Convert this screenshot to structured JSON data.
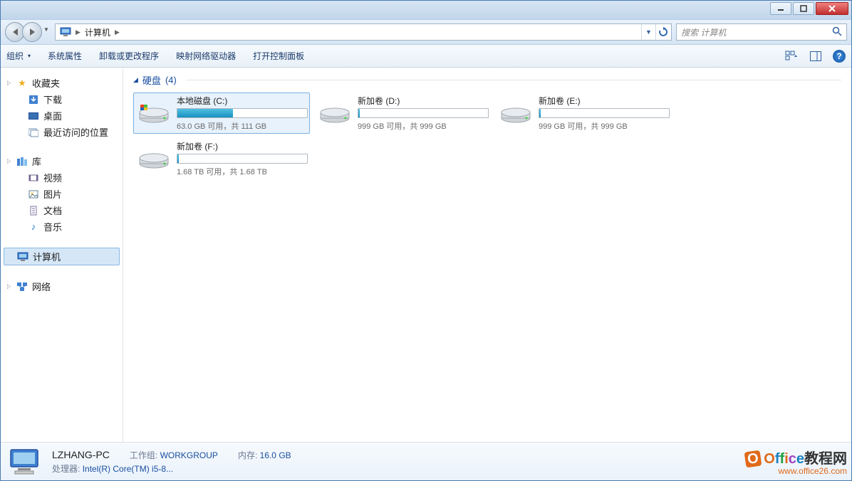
{
  "breadcrumb": {
    "root": "计算机"
  },
  "search": {
    "placeholder": "搜索 计算机"
  },
  "toolbar": {
    "organize": "组织",
    "props": "系统属性",
    "uninstall": "卸载或更改程序",
    "mapdrive": "映射网络驱动器",
    "controlpanel": "打开控制面板"
  },
  "sidebar": {
    "favorites": {
      "label": "收藏夹",
      "items": [
        "下载",
        "桌面",
        "最近访问的位置"
      ]
    },
    "libraries": {
      "label": "库",
      "items": [
        "视频",
        "图片",
        "文档",
        "音乐"
      ]
    },
    "computer": {
      "label": "计算机"
    },
    "network": {
      "label": "网络"
    }
  },
  "category": {
    "label": "硬盘",
    "count": "(4)"
  },
  "drives": [
    {
      "name": "本地磁盘 (C:)",
      "free": "63.0 GB 可用，共 111 GB",
      "fill_pct": 43,
      "system": true,
      "selected": true
    },
    {
      "name": "新加卷 (D:)",
      "free": "999 GB 可用，共 999 GB",
      "fill_pct": 1,
      "system": false,
      "selected": false
    },
    {
      "name": "新加卷 (E:)",
      "free": "999 GB 可用，共 999 GB",
      "fill_pct": 1,
      "system": false,
      "selected": false
    },
    {
      "name": "新加卷 (F:)",
      "free": "1.68 TB 可用，共 1.68 TB",
      "fill_pct": 1,
      "system": false,
      "selected": false
    }
  ],
  "details": {
    "name": "LZHANG-PC",
    "workgroup_label": "工作组:",
    "workgroup": "WORKGROUP",
    "mem_label": "内存:",
    "mem": "16.0 GB",
    "cpu_label": "处理器:",
    "cpu": "Intel(R) Core(TM) i5-8..."
  },
  "watermark": {
    "brand_suffix": "教程网",
    "url": "www.office26.com"
  }
}
